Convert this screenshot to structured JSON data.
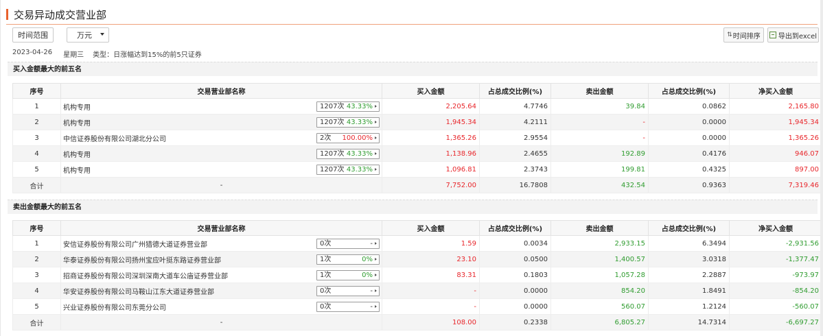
{
  "header": {
    "title": "交易异动成交营业部"
  },
  "toolbar": {
    "range_label": "时间范围",
    "unit_label": "万元",
    "sort_label": "时间排序",
    "export_label": "导出到excel"
  },
  "meta": {
    "date": "2023-04-26",
    "weekday": "星期三",
    "type": "类型：日涨幅达到15%的前5只证券"
  },
  "columns": [
    "序号",
    "交易营业部名称",
    "买入金额",
    "占总成交比例(%)",
    "卖出金额",
    "占总成交比例(%)",
    "净买入金额"
  ],
  "buy_section": {
    "title": "买入金额最大的前五名",
    "rows": [
      {
        "no": "1",
        "name": "机构专用",
        "count": "1207次",
        "rate": "43.33%",
        "buy": "2,205.64",
        "buy_pct": "4.7746",
        "sell": "39.84",
        "sell_pct": "0.0862",
        "net": "2,165.80"
      },
      {
        "no": "2",
        "name": "机构专用",
        "count": "1207次",
        "rate": "43.33%",
        "buy": "1,945.34",
        "buy_pct": "4.2111",
        "sell": "-",
        "sell_pct": "0.0000",
        "net": "1,945.34"
      },
      {
        "no": "3",
        "name": "中信证券股份有限公司湖北分公司",
        "count": "2次",
        "rate": "100.00%",
        "buy": "1,365.26",
        "buy_pct": "2.9554",
        "sell": "-",
        "sell_pct": "0.0000",
        "net": "1,365.26"
      },
      {
        "no": "4",
        "name": "机构专用",
        "count": "1207次",
        "rate": "43.33%",
        "buy": "1,138.96",
        "buy_pct": "2.4655",
        "sell": "192.89",
        "sell_pct": "0.4176",
        "net": "946.07"
      },
      {
        "no": "5",
        "name": "机构专用",
        "count": "1207次",
        "rate": "43.33%",
        "buy": "1,096.81",
        "buy_pct": "2.3743",
        "sell": "199.81",
        "sell_pct": "0.4325",
        "net": "897.00"
      }
    ],
    "total": {
      "label": "合计",
      "name": "-",
      "buy": "7,752.00",
      "buy_pct": "16.7808",
      "sell": "432.54",
      "sell_pct": "0.9363",
      "net": "7,319.46"
    }
  },
  "sell_section": {
    "title": "卖出金额最大的前五名",
    "rows": [
      {
        "no": "1",
        "name": "安信证券股份有限公司广州猎德大道证券营业部",
        "count": "0次",
        "rate": "-",
        "buy": "1.59",
        "buy_pct": "0.0034",
        "sell": "2,933.15",
        "sell_pct": "6.3494",
        "net": "-2,931.56"
      },
      {
        "no": "2",
        "name": "华泰证券股份有限公司扬州宝应叶挺东路证券营业部",
        "count": "1次",
        "rate": "0%",
        "buy": "23.10",
        "buy_pct": "0.0500",
        "sell": "1,400.57",
        "sell_pct": "3.0318",
        "net": "-1,377.47"
      },
      {
        "no": "3",
        "name": "招商证券股份有限公司深圳深南大道车公庙证券营业部",
        "count": "1次",
        "rate": "0%",
        "buy": "83.31",
        "buy_pct": "0.1803",
        "sell": "1,057.28",
        "sell_pct": "2.2887",
        "net": "-973.97"
      },
      {
        "no": "4",
        "name": "华安证券股份有限公司马鞍山江东大道证券营业部",
        "count": "0次",
        "rate": "-",
        "buy": "-",
        "buy_pct": "0.0000",
        "sell": "854.20",
        "sell_pct": "1.8491",
        "net": "-854.20"
      },
      {
        "no": "5",
        "name": "兴业证券股份有限公司东莞分公司",
        "count": "0次",
        "rate": "-",
        "buy": "-",
        "buy_pct": "0.0000",
        "sell": "560.07",
        "sell_pct": "1.2124",
        "net": "-560.07"
      }
    ],
    "total": {
      "label": "合计",
      "name": "-",
      "buy": "108.00",
      "buy_pct": "0.2338",
      "sell": "6,805.27",
      "sell_pct": "14.7314",
      "net": "-6,697.27"
    }
  },
  "colors": {
    "accent": "#e8612c",
    "red": "#e8262b",
    "green": "#2f9c2f"
  }
}
